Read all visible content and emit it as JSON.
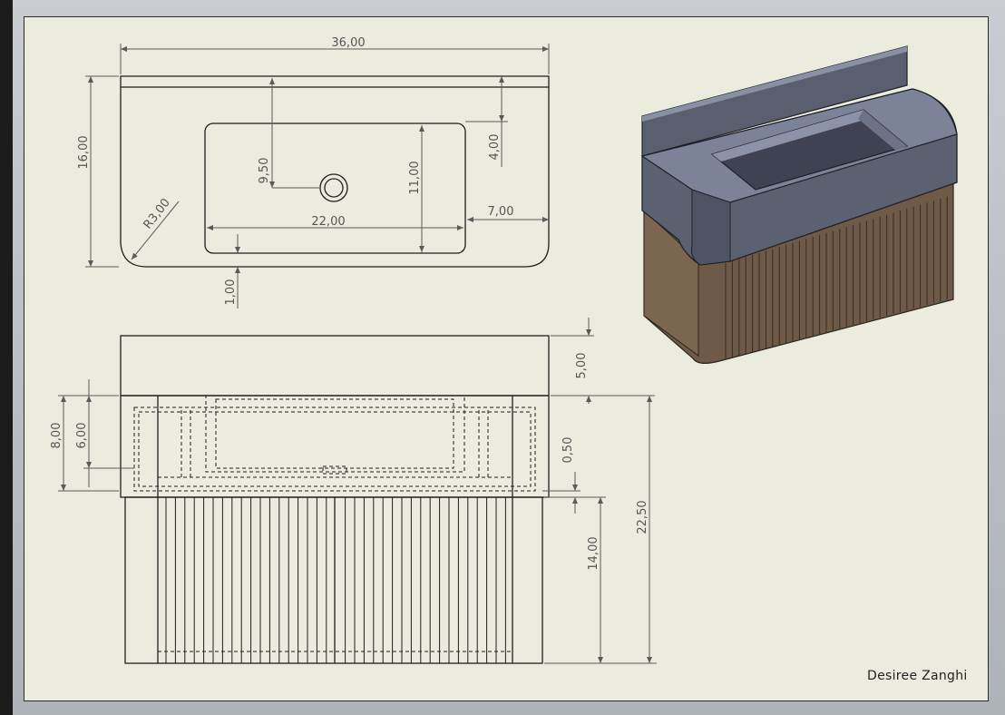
{
  "drawing": {
    "author": "Desiree Zanghi",
    "dimensions": {
      "overall_width": "36,00",
      "basin_width": "22,00",
      "depth": "16,00",
      "drain_offset": "9,50",
      "basin_depth": "11,00",
      "back_offset": "4,00",
      "side_offset": "7,00",
      "corner_radius": "R3,00",
      "front_offset": "1,00",
      "top_thickness": "5,00",
      "upper_height": "8,00",
      "inner_height": "6,00",
      "gap": "0,50",
      "cabinet_height": "14,00",
      "total_height": "22,50"
    }
  },
  "colors": {
    "sheet": "#ececde",
    "line": "#1e1e1e",
    "dim_line": "#5a5a5a",
    "top_dark": "#5a5f70",
    "top_light": "#7b8196",
    "wood": "#6f5a48"
  }
}
